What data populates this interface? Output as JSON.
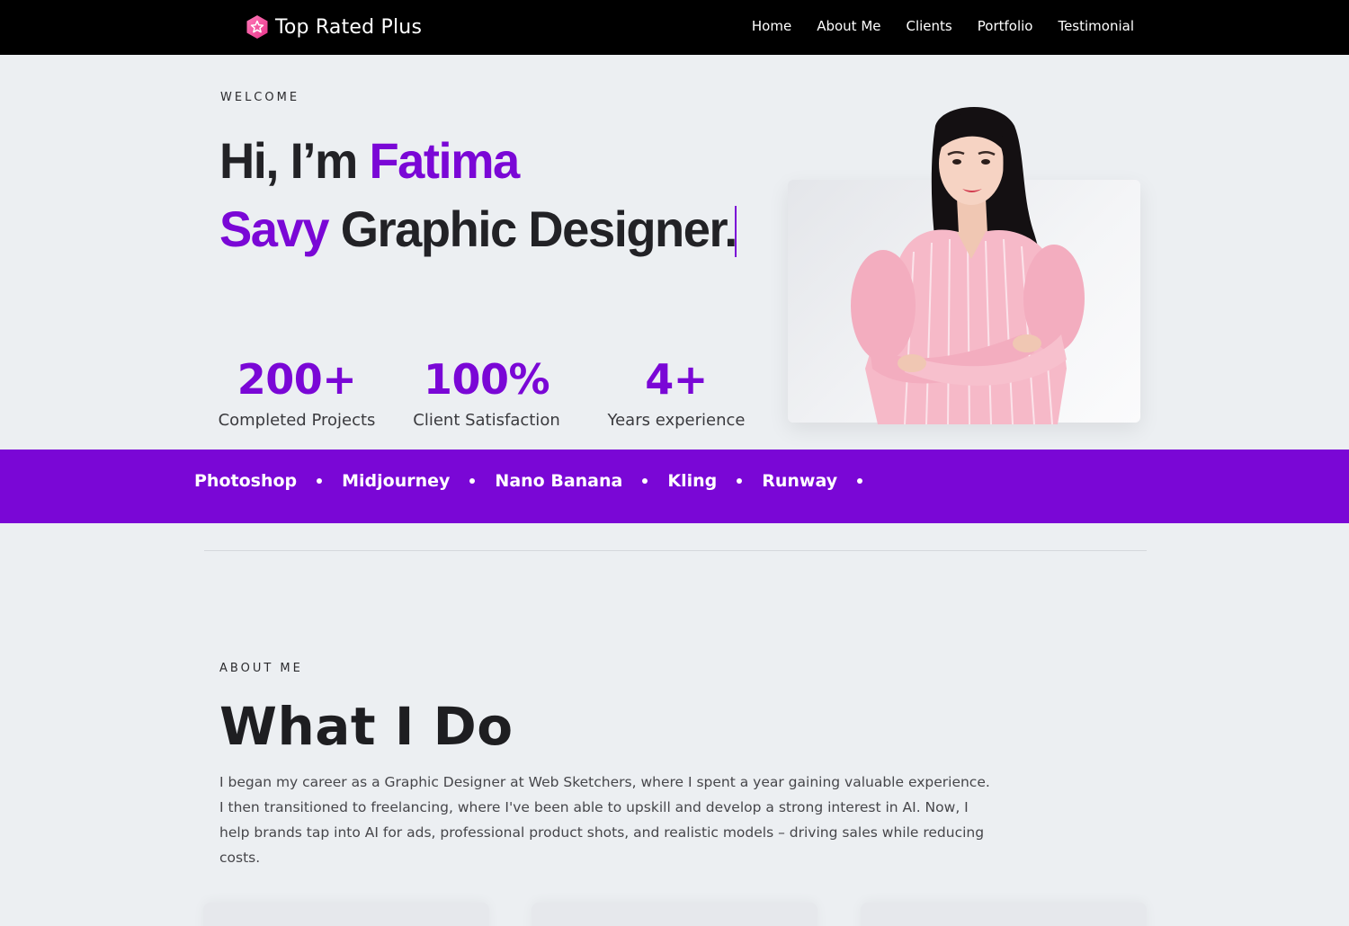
{
  "brand": {
    "name": "Top Rated Plus",
    "logo_icon": "star-badge-icon",
    "logo_color": "#ff4fa3"
  },
  "nav": {
    "items": [
      "Home",
      "About Me",
      "Clients",
      "Portfolio",
      "Testimonial"
    ]
  },
  "hero": {
    "eyebrow": "WELCOME",
    "greeting": "Hi, I’m ",
    "name": "Fatima",
    "typed_word": "Savy",
    "role": "Graphic Designer.",
    "accent_color": "#7a07d6"
  },
  "stats": [
    {
      "value": "200+",
      "label": "Completed Projects"
    },
    {
      "value": "100%",
      "label": "Client Satisfaction"
    },
    {
      "value": "4+",
      "label": "Years experience"
    }
  ],
  "skills": [
    "Photoshop",
    "Midjourney",
    "Nano Banana",
    "Kling",
    "Runway"
  ],
  "about": {
    "eyebrow": "ABOUT ME",
    "title": "What I Do",
    "body": "I began my career as a Graphic Designer at Web Sketchers, where I spent a year gaining valuable experience. I then transitioned to freelancing, where I've been able to upskill and develop a strong interest in AI. Now, I help brands tap into AI for ads, professional product shots, and realistic models – driving sales while reducing costs."
  }
}
